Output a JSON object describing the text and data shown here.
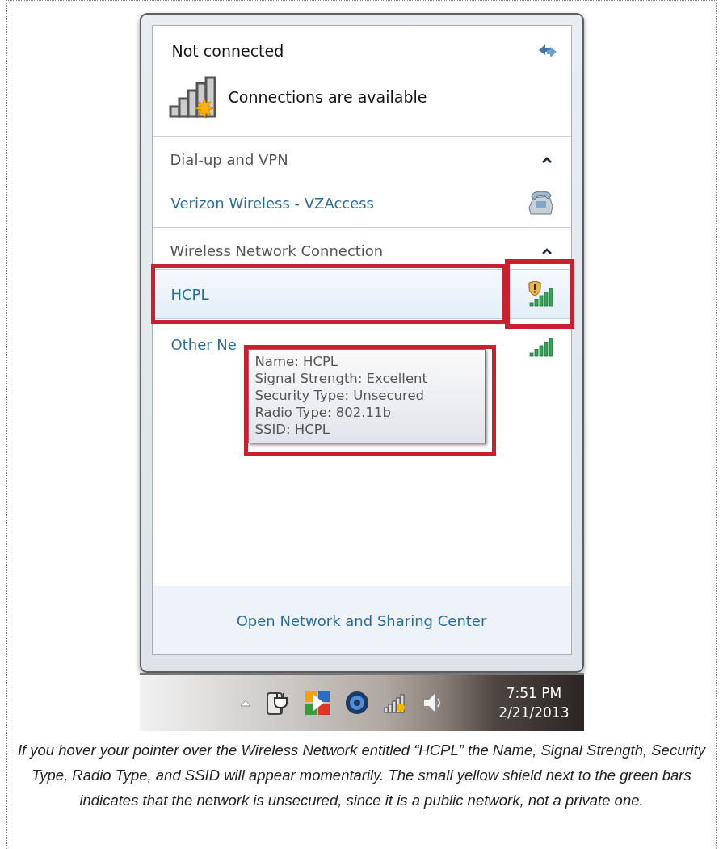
{
  "flyout": {
    "status": "Not connected",
    "availability": "Connections are available",
    "sections": [
      {
        "title": "Dial-up and VPN",
        "expanded": true,
        "items": [
          {
            "kind": "dialup",
            "name": "Verizon Wireless - VZAccess",
            "selected": false,
            "highlighted": false
          }
        ]
      },
      {
        "title": "Wireless Network Connection",
        "expanded": true,
        "items": [
          {
            "kind": "wifi",
            "name": "HCPL",
            "selected": true,
            "highlighted": true,
            "unsecured": true
          },
          {
            "kind": "wifi",
            "name": "Other Ne",
            "selected": false,
            "highlighted": false,
            "unsecured": false
          }
        ]
      }
    ],
    "tooltip": {
      "highlighted": true,
      "lines": [
        "Name: HCPL",
        "Signal Strength: Excellent",
        "Security Type: Unsecured",
        "Radio Type: 802.11b",
        "SSID: HCPL"
      ]
    },
    "footer_link": "Open Network and Sharing Center"
  },
  "taskbar": {
    "time": "7:51 PM",
    "date": "2/21/2013"
  },
  "caption": "If you hover your pointer over the Wireless Network entitled “HCPL” the Name, Signal Strength, Security Type, Radio Type, and SSID will appear momentarily. The small yellow shield next to the green bars indicates that the network is unsecured, since it is a public network, not a private one."
}
